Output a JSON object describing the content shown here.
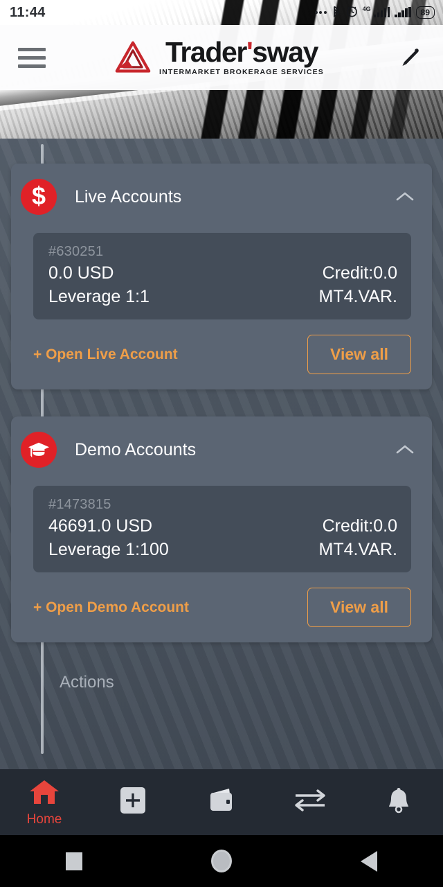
{
  "status_bar": {
    "clock": "11:44",
    "battery_percent": "89",
    "network_type": "4G",
    "icons": [
      "dots-icon",
      "bluetooth-icon",
      "alarm-icon",
      "signal-bars-icon",
      "signal-bars-icon",
      "battery-icon"
    ]
  },
  "header": {
    "menu_icon": "hamburger-menu-icon",
    "logo_word_1": "Trader",
    "logo_apostrophe": "'",
    "logo_word_2": "sway",
    "logo_tagline": "INTERMARKET BROKERAGE SERVICES",
    "logo_mark_icon": "triangle-logo-icon",
    "edit_icon": "pencil-icon",
    "brand_red": "#c8272d"
  },
  "accent": {
    "orange": "#ef9e48",
    "red": "#e02127",
    "card_bg": "#5b6573",
    "inner_bg": "#444d59",
    "nav_bg": "#242a33"
  },
  "sections": [
    {
      "key": "live",
      "title": "Live Accounts",
      "badge_icon": "dollar-sign-icon",
      "collapse_icon": "chevron-up-icon",
      "account": {
        "id": "#630251",
        "balance": "0.0 USD",
        "credit": "Credit:0.0",
        "leverage": "Leverage 1:1",
        "platform": "MT4.VAR."
      },
      "open_link": "+ Open Live Account",
      "view_all": "View all"
    },
    {
      "key": "demo",
      "title": "Demo Accounts",
      "badge_icon": "graduation-cap-icon",
      "collapse_icon": "chevron-up-icon",
      "account": {
        "id": "#1473815",
        "balance": "46691.0 USD",
        "credit": "Credit:0.0",
        "leverage": "Leverage 1:100",
        "platform": "MT4.VAR."
      },
      "open_link": "+ Open Demo Account",
      "view_all": "View all"
    }
  ],
  "actions_label": "Actions",
  "bottom_nav": [
    {
      "label": "Home",
      "icon": "home-icon",
      "active": true
    },
    {
      "label": "",
      "icon": "plus-square-icon",
      "active": false
    },
    {
      "label": "",
      "icon": "wallet-icon",
      "active": false
    },
    {
      "label": "",
      "icon": "transfer-arrows-icon",
      "active": false
    },
    {
      "label": "",
      "icon": "bell-icon",
      "active": false
    }
  ],
  "system_nav": [
    {
      "icon": "recents-square-icon"
    },
    {
      "icon": "home-circle-icon"
    },
    {
      "icon": "back-triangle-icon"
    }
  ]
}
